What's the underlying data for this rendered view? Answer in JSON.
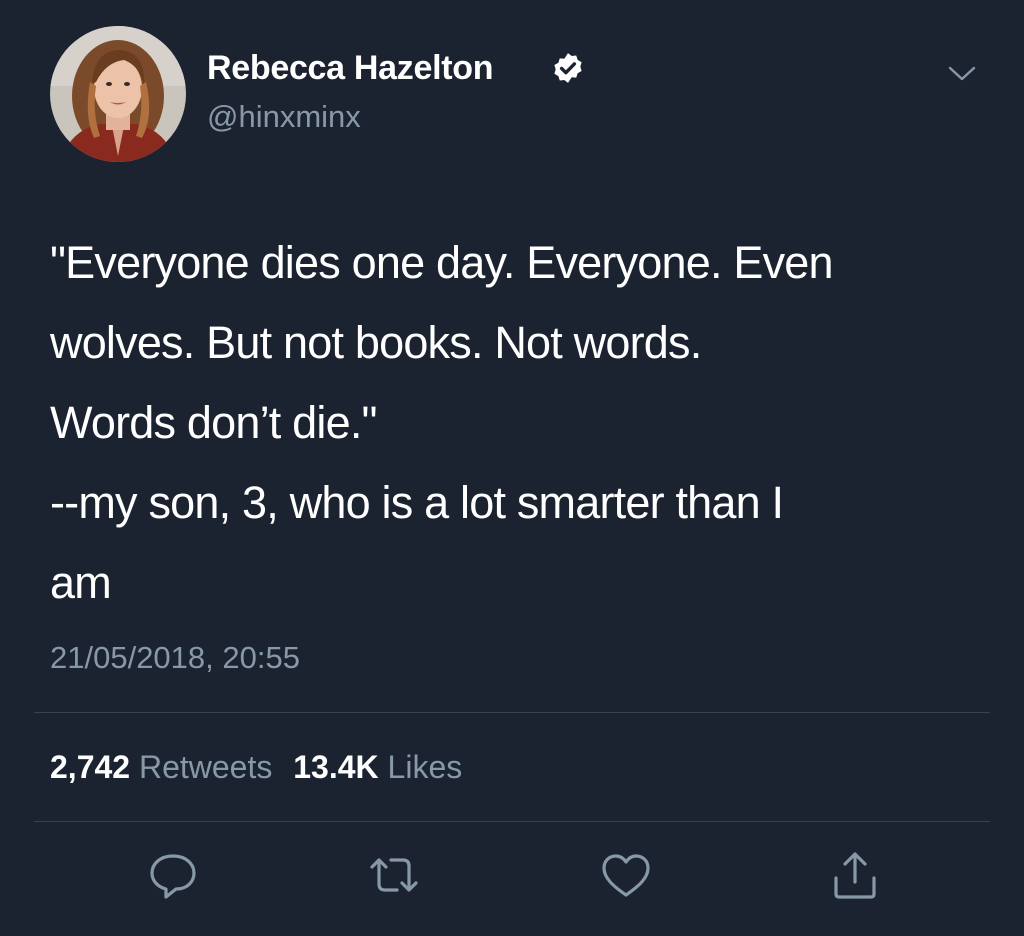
{
  "tweet": {
    "author": {
      "display_name": "Rebecca Hazelton",
      "handle": "@hinxminx",
      "verified": true,
      "avatar": "profile-photo"
    },
    "text_lines": [
      "\"Everyone dies one day. Everyone. Even",
      "wolves. But not books. Not words.",
      "Words don’t die.\"",
      "--my son, 3, who is a lot smarter than I",
      "am"
    ],
    "timestamp": "21/05/2018, 20:55",
    "stats": {
      "retweets_count": "2,742",
      "retweets_label": "Retweets",
      "likes_count": "13.4K",
      "likes_label": "Likes"
    },
    "actions": [
      {
        "name": "reply",
        "icon": "reply-icon"
      },
      {
        "name": "retweet",
        "icon": "retweet-icon"
      },
      {
        "name": "like",
        "icon": "heart-icon"
      },
      {
        "name": "share",
        "icon": "share-icon"
      }
    ]
  },
  "colors": {
    "background": "#1c2330",
    "primary_text": "#ffffff",
    "secondary_text": "#8899a6",
    "divider": "#38444d",
    "verified_badge": "#ffffff"
  }
}
